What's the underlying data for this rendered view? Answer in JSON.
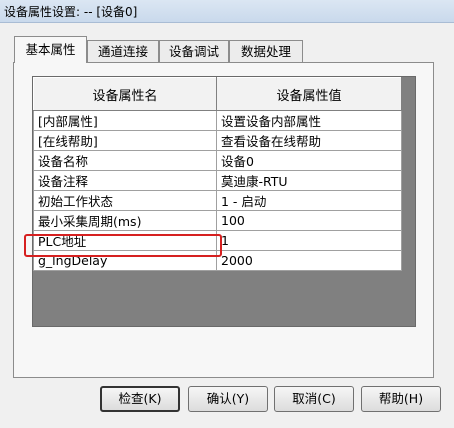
{
  "window": {
    "title": "设备属性设置: -- [设备0]"
  },
  "tabs": [
    "基本属性",
    "通道连接",
    "设备调试",
    "数据处理"
  ],
  "table": {
    "headers": [
      "设备属性名",
      "设备属性值"
    ],
    "rows": [
      [
        "[内部属性]",
        "设置设备内部属性"
      ],
      [
        "[在线帮助]",
        "查看设备在线帮助"
      ],
      [
        "设备名称",
        "设备0"
      ],
      [
        "设备注释",
        "莫迪康-RTU"
      ],
      [
        "初始工作状态",
        "1 - 启动"
      ],
      [
        "最小采集周期(ms)",
        "100"
      ],
      [
        "PLC地址",
        "1"
      ],
      [
        "g_lngDelay",
        "2000"
      ]
    ]
  },
  "buttons": {
    "check": "检查(K)",
    "ok": "确认(Y)",
    "cancel": "取消(C)",
    "help": "帮助(H)"
  }
}
